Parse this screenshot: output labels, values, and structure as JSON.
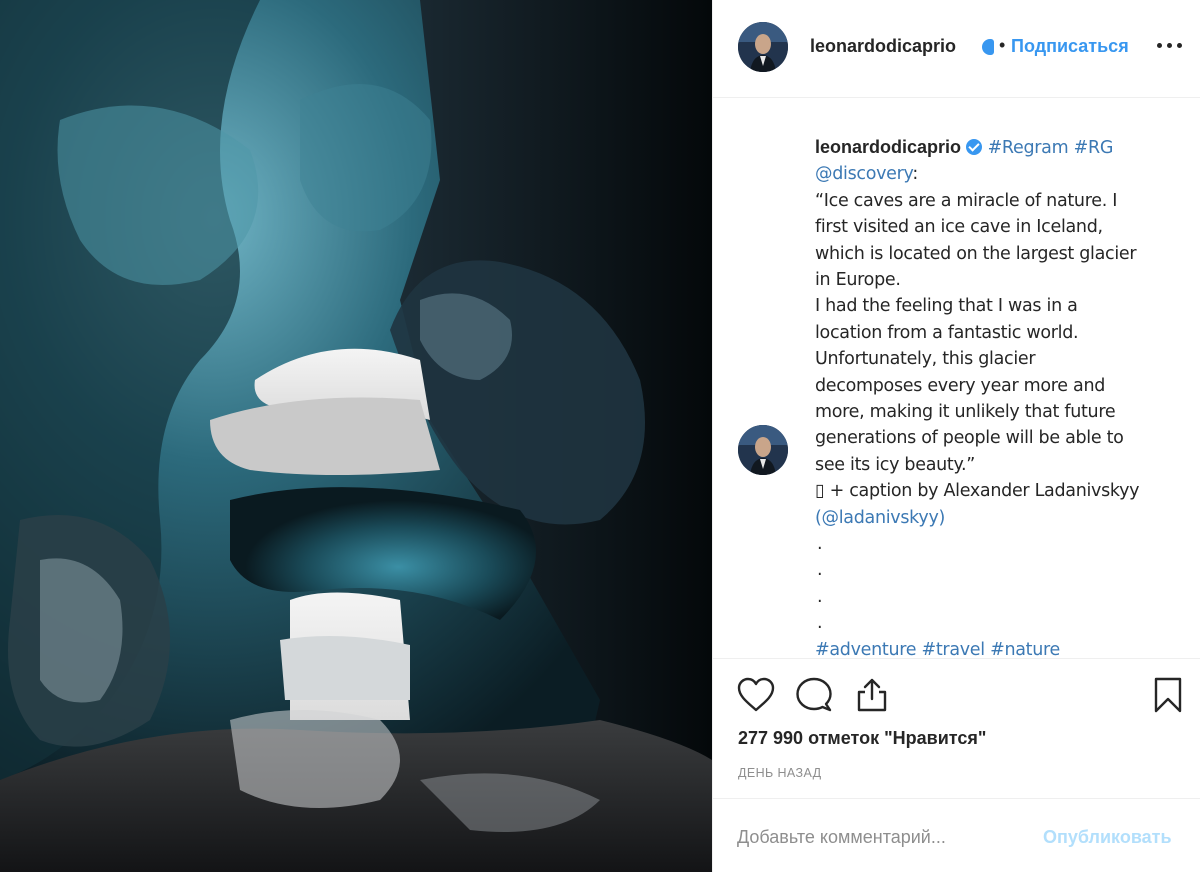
{
  "post": {
    "username": "leonardodicaprio",
    "verified": true,
    "follow_label": "Подписаться",
    "more_icon": "more-horizontal-icon"
  },
  "caption": {
    "username": "leonardodicaprio",
    "tags_line1": "#Regram #RG",
    "mention": "@discovery",
    "mention_suffix": ":",
    "lines": [
      "“Ice caves are a miracle of nature. I",
      "first visited an ice cave in Iceland,",
      "which is located on the largest glacier",
      "in Europe.",
      "I had the feeling that I was in a",
      "location from a fantastic world.",
      "Unfortunately, this glacier",
      "decomposes every year more and",
      "more, making it unlikely that future",
      "generations of people will be able to",
      "see its icy beauty.”"
    ],
    "credit_line": "▯ + caption by Alexander Ladanivskyy",
    "credit_link": "(@ladanivskyy)",
    "dots": [
      ".",
      ".",
      ".",
      "."
    ],
    "hashtags": "#adventure #travel #nature"
  },
  "actions": {
    "like_icon": "heart-icon",
    "comment_icon": "comment-icon",
    "share_icon": "share-icon",
    "save_icon": "bookmark-icon"
  },
  "likes_text": "277 990 отметок \"Нравится\"",
  "timestamp": "ДЕНЬ НАЗАД",
  "comment": {
    "placeholder": "Добавьте комментарий...",
    "publish_label": "Опубликовать"
  },
  "colors": {
    "link": "#3897f0",
    "publish_disabled": "#b2dffc",
    "muted": "#8e8e8e"
  }
}
